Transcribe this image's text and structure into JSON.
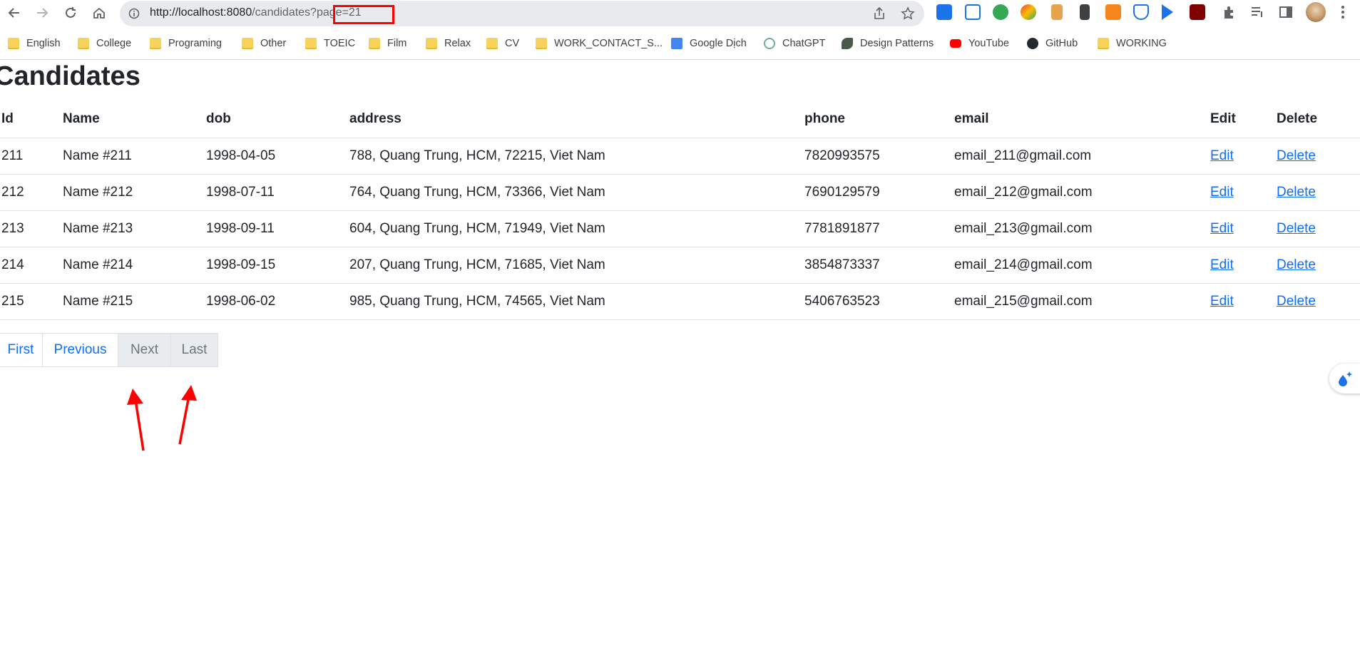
{
  "browser": {
    "url_host": "http://localhost:8080",
    "url_path": "/candidates?page=21",
    "bookmarks": [
      {
        "label": "English",
        "icon": "folder-icon"
      },
      {
        "label": "College",
        "icon": "folder-icon"
      },
      {
        "label": "Programing",
        "icon": "folder-icon"
      },
      {
        "label": "Other",
        "icon": "folder-icon"
      },
      {
        "label": "TOEIC",
        "icon": "folder-icon"
      },
      {
        "label": "Film",
        "icon": "folder-icon"
      },
      {
        "label": "Relax",
        "icon": "folder-icon"
      },
      {
        "label": "CV",
        "icon": "folder-icon"
      },
      {
        "label": "WORK_CONTACT_S...",
        "icon": "folder-icon"
      },
      {
        "label": "Google Dịch",
        "icon": "google-translate-icon"
      },
      {
        "label": "ChatGPT",
        "icon": "chatgpt-icon"
      },
      {
        "label": "Design Patterns",
        "icon": "design-patterns-icon"
      },
      {
        "label": "YouTube",
        "icon": "youtube-icon"
      },
      {
        "label": "GitHub",
        "icon": "github-icon"
      },
      {
        "label": "WORKING",
        "icon": "folder-icon"
      }
    ]
  },
  "page": {
    "title": "Candidates",
    "columns": [
      "Id",
      "Name",
      "dob",
      "address",
      "phone",
      "email",
      "Edit",
      "Delete"
    ],
    "rows": [
      {
        "id": "211",
        "name": "Name #211",
        "dob": "1998-04-05",
        "address": "788, Quang Trung, HCM, 72215, Viet Nam",
        "phone": "7820993575",
        "email": "email_211@gmail.com",
        "edit": "Edit",
        "delete": "Delete"
      },
      {
        "id": "212",
        "name": "Name #212",
        "dob": "1998-07-11",
        "address": "764, Quang Trung, HCM, 73366, Viet Nam",
        "phone": "7690129579",
        "email": "email_212@gmail.com",
        "edit": "Edit",
        "delete": "Delete"
      },
      {
        "id": "213",
        "name": "Name #213",
        "dob": "1998-09-11",
        "address": "604, Quang Trung, HCM, 71949, Viet Nam",
        "phone": "7781891877",
        "email": "email_213@gmail.com",
        "edit": "Edit",
        "delete": "Delete"
      },
      {
        "id": "214",
        "name": "Name #214",
        "dob": "1998-09-15",
        "address": "207, Quang Trung, HCM, 71685, Viet Nam",
        "phone": "3854873337",
        "email": "email_214@gmail.com",
        "edit": "Edit",
        "delete": "Delete"
      },
      {
        "id": "215",
        "name": "Name #215",
        "dob": "1998-06-02",
        "address": "985, Quang Trung, HCM, 74565, Viet Nam",
        "phone": "5406763523",
        "email": "email_215@gmail.com",
        "edit": "Edit",
        "delete": "Delete"
      }
    ],
    "pagination": {
      "first": "First",
      "previous": "Previous",
      "next": "Next",
      "last": "Last"
    }
  },
  "colors": {
    "link": "#0d6efd",
    "annotation": "#ff0000",
    "disabled_bg": "#e9ecef"
  }
}
